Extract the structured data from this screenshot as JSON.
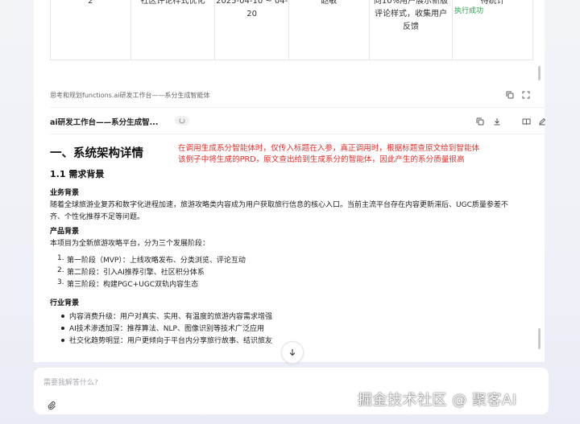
{
  "table": {
    "row": [
      "2",
      "社区评论样式优化",
      "2025-04-10 ~ 04-\n20",
      "赵敏",
      "向10%用户展示新版\n评论样式，收集用户\n反馈",
      "待统计"
    ]
  },
  "tool": {
    "title": "思考和规划functions.ai研发工作台——系分生成智能体",
    "status": "执行成功",
    "copy_icon": "copy-icon",
    "expand_icon": "expand-icon"
  },
  "doc": {
    "title": "ai研发工作台——系分生成智...",
    "loader_icon": "spinner-icon",
    "actions": [
      "copy-icon",
      "download-icon",
      "book-icon",
      "edit-icon"
    ]
  },
  "content": {
    "h1": "一、系统架构详情",
    "annotation_line1": "在调用生成系分智能体时，仅传入标题在入参，真正调用时，根据标题查原文给到智能体",
    "annotation_line2": "该例子中将生成的PRD，原文查出给到生成系分的智能体，因此产生的系分质量很高",
    "h2": "1.1 需求背景",
    "business_title": "业务背景",
    "business_text_1": "随着全球旅游业复苏和数字化进程加速，旅游攻略类内容成为用户获取旅行信息的核心入口。当前主流平台存在内容更新滞后、UGC质量参差不",
    "business_text_2": "齐、个性化推荐不足等问题。",
    "product_title": "产品背景",
    "product_text": "本项目为全新旅游攻略平台，分为三个发展阶段：",
    "phases": [
      {
        "num": "1.",
        "text": "第一阶段（MVP）：上线攻略发布、分类浏览、评论互动"
      },
      {
        "num": "2.",
        "text": "第二阶段：引入AI推荐引擎、社区积分体系"
      },
      {
        "num": "3.",
        "text": "第三阶段：构建PGC+UGC双轨内容生态"
      }
    ],
    "industry_title": "行业背景",
    "industry_items": [
      "内容消费升级：用户对真实、实用、有温度的旅游内容需求增强",
      "AI技术渗透加深：推荐算法、NLP、图像识别等技术广泛应用",
      "社交化趋势明显：用户更倾向于平台内分享旅行故事、结识旅友"
    ]
  },
  "input": {
    "placeholder": "需要我解答什么?",
    "attach_icon": "paperclip-icon"
  },
  "watermark": "掘金技术社区 @ 聚客AI",
  "colors": {
    "annotation": "#e0302a",
    "status_success": "#21a34a"
  }
}
